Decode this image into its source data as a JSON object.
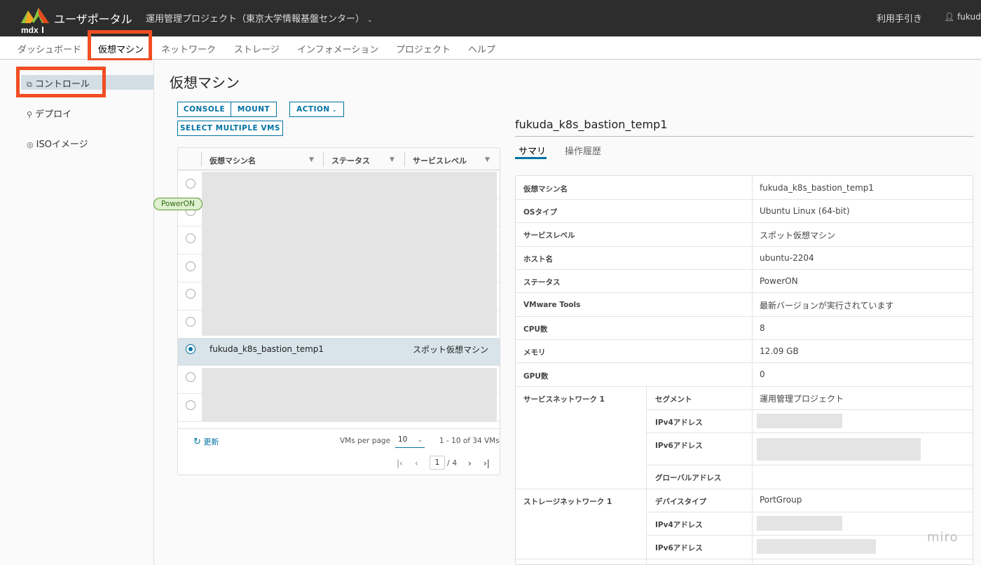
{
  "header": {
    "logo_text": "mdx",
    "brand": "ユーザポータル",
    "project": "運用管理プロジェクト（東京大学情報基盤センター）",
    "guide": "利用手引き",
    "user": "fukuda"
  },
  "nav": {
    "items": [
      "ダッシュボード",
      "仮想マシン",
      "ネットワーク",
      "ストレージ",
      "インフォメーション",
      "プロジェクト",
      "ヘルプ"
    ],
    "active": "仮想マシン"
  },
  "sidebar": {
    "items": [
      {
        "label": "コントロール",
        "icon": "vm-copy-icon"
      },
      {
        "label": "デプロイ",
        "icon": "deploy-icon"
      },
      {
        "label": "ISOイメージ",
        "icon": "disc-icon"
      }
    ]
  },
  "page": {
    "title": "仮想マシン"
  },
  "toolbar": {
    "console": "CONSOLE",
    "mount": "MOUNT",
    "action": "ACTION",
    "select_multiple": "SELECT MULTIPLE VMS"
  },
  "grid": {
    "columns": [
      "仮想マシン名",
      "ステータス",
      "サービスレベル"
    ],
    "selected_row": {
      "name": "fukuda_k8s_bastion_temp1",
      "status": "PowerON",
      "service_level": "スポット仮想マシン"
    },
    "footer": {
      "refresh": "更新",
      "per_page_label": "VMs per page",
      "per_page_value": "10",
      "range": "1 - 10 of 34 VMs",
      "current_page": "1",
      "total_pages": "/ 4"
    }
  },
  "detail": {
    "title": "fukuda_k8s_bastion_temp1",
    "tabs": [
      "サマリ",
      "操作履歴"
    ],
    "rows": [
      {
        "label": "仮想マシン名",
        "value": "fukuda_k8s_bastion_temp1"
      },
      {
        "label": "OSタイプ",
        "value": "Ubuntu Linux (64-bit)"
      },
      {
        "label": "サービスレベル",
        "value": "スポット仮想マシン"
      },
      {
        "label": "ホスト名",
        "value": "ubuntu-2204"
      },
      {
        "label": "ステータス",
        "value": "PowerON"
      },
      {
        "label": "VMware Tools",
        "value": "最新バージョンが実行されています"
      },
      {
        "label": "CPU数",
        "value": "8"
      },
      {
        "label": "メモリ",
        "value": "12.09 GB"
      },
      {
        "label": "GPU数",
        "value": "0"
      }
    ],
    "service_network": {
      "label": "サービスネットワーク 1",
      "segment_label": "セグメント",
      "segment_value": "運用管理プロジェクト",
      "ipv4_label": "IPv4アドレス",
      "ipv6_label": "IPv6アドレス",
      "global_label": "グローバルアドレス"
    },
    "storage_network": {
      "label": "ストレージネットワーク 1",
      "device_label": "デバイスタイプ",
      "device_value": "PortGroup",
      "ipv4_label": "IPv4アドレス",
      "ipv6_label": "IPv6アドレス"
    }
  },
  "watermark": "miro"
}
